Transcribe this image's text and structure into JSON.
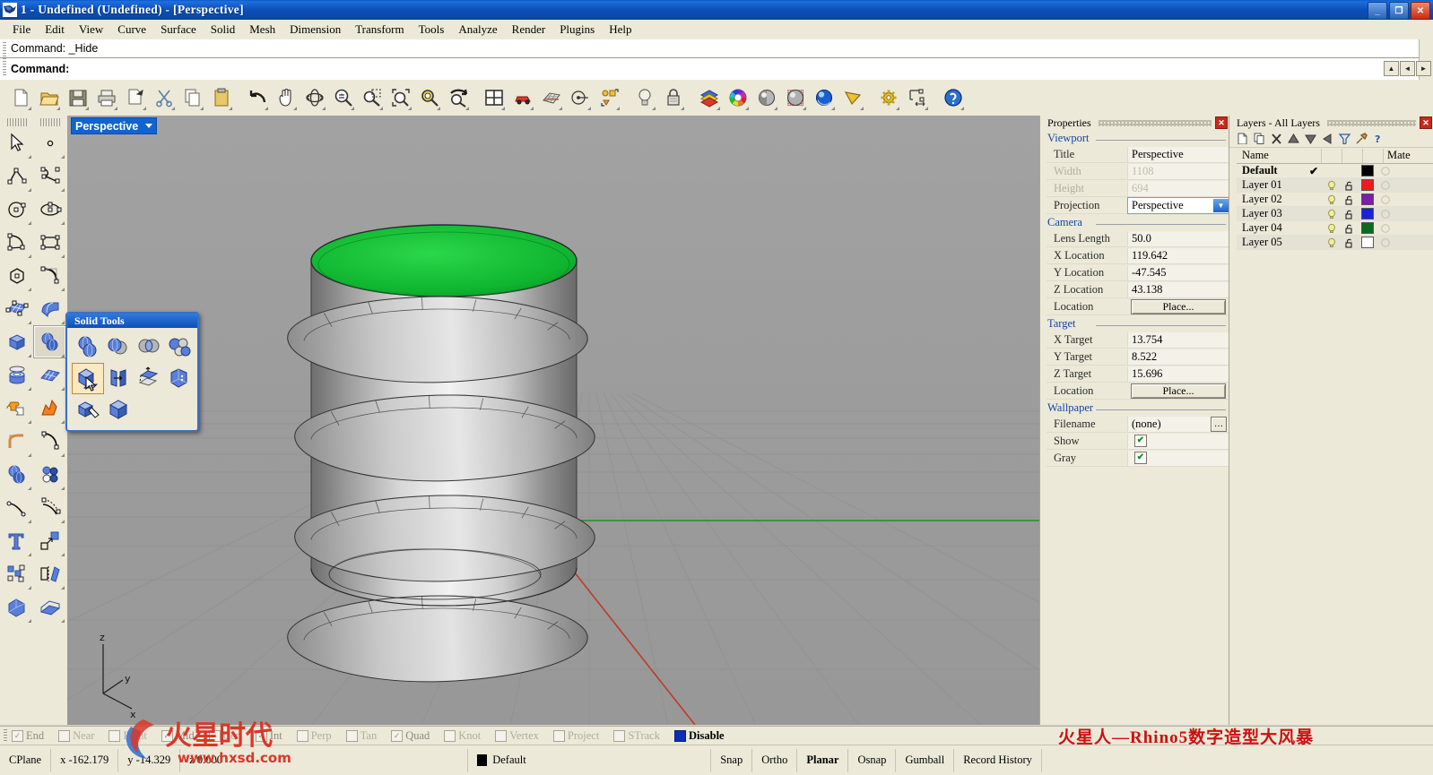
{
  "window": {
    "title": "1 - Undefined (Undefined) - [Perspective]",
    "app_icon": "rhino-logo-icon",
    "minimize_label": "_",
    "restore_label": "❐",
    "close_label": "✕"
  },
  "menubar": {
    "items": [
      {
        "label": "File",
        "accel": "F"
      },
      {
        "label": "Edit",
        "accel": "E"
      },
      {
        "label": "View",
        "accel": "V"
      },
      {
        "label": "Curve",
        "accel": "C"
      },
      {
        "label": "Surface",
        "accel": "S"
      },
      {
        "label": "Solid",
        "accel": "l"
      },
      {
        "label": "Mesh",
        "accel": "M"
      },
      {
        "label": "Dimension",
        "accel": "D"
      },
      {
        "label": "Transform",
        "accel": "T"
      },
      {
        "label": "Tools",
        "accel": "s"
      },
      {
        "label": "Analyze",
        "accel": "A"
      },
      {
        "label": "Render",
        "accel": "R"
      },
      {
        "label": "Plugins",
        "accel": "P"
      },
      {
        "label": "Help",
        "accel": "H"
      }
    ]
  },
  "command": {
    "history_line": "Command: _Hide",
    "prompt_line": "Command:",
    "scroll_up": "▲",
    "scroll_prev": "◄",
    "scroll_next": "►"
  },
  "toolbar": {
    "buttons": [
      {
        "name": "new-file-icon",
        "tip": "New"
      },
      {
        "name": "open-file-icon",
        "tip": "Open"
      },
      {
        "name": "save-file-icon",
        "tip": "Save"
      },
      {
        "name": "print-icon",
        "tip": "Print"
      },
      {
        "name": "cut-page-icon",
        "tip": "Cut"
      },
      {
        "name": "scissors-icon",
        "tip": "Cut"
      },
      {
        "name": "copy-icon",
        "tip": "Copy"
      },
      {
        "name": "paste-icon",
        "tip": "Paste"
      },
      {
        "name": "undo-icon",
        "tip": "Undo"
      },
      {
        "name": "pan-hand-icon",
        "tip": "Pan"
      },
      {
        "name": "rotate-view-icon",
        "tip": "Rotate View"
      },
      {
        "name": "zoom-in-out-icon",
        "tip": "Zoom"
      },
      {
        "name": "zoom-window-icon",
        "tip": "Zoom Window"
      },
      {
        "name": "zoom-extents-icon",
        "tip": "Zoom Extents"
      },
      {
        "name": "zoom-selected-icon",
        "tip": "Zoom Selected"
      },
      {
        "name": "zoom-previous-icon",
        "tip": "Zoom Previous"
      },
      {
        "name": "four-view-icon",
        "tip": "4 Viewports"
      },
      {
        "name": "car-icon",
        "tip": "Named Views"
      },
      {
        "name": "grid-plane-icon",
        "tip": "CPlane"
      },
      {
        "name": "circle-radius-icon",
        "tip": "Set CPlane"
      },
      {
        "name": "select-objects-icon",
        "tip": "Selection"
      },
      {
        "name": "light-bulb-icon",
        "tip": "Lights"
      },
      {
        "name": "lock-icon",
        "tip": "Lock"
      },
      {
        "name": "layers-stack-icon",
        "tip": "Layers"
      },
      {
        "name": "color-wheel-icon",
        "tip": "Object Color"
      },
      {
        "name": "shaded-sphere-icon",
        "tip": "Shaded"
      },
      {
        "name": "ghosted-sphere-icon",
        "tip": "Ghosted"
      },
      {
        "name": "rendered-sphere-icon",
        "tip": "Rendered"
      },
      {
        "name": "render-preview-icon",
        "tip": "Render"
      },
      {
        "name": "options-gear-icon",
        "tip": "Options"
      },
      {
        "name": "dimension-icon",
        "tip": "Dimension"
      },
      {
        "name": "help-icon",
        "tip": "Help"
      }
    ]
  },
  "left_toolbar": {
    "column_left": [
      "arrow-select-icon",
      "polyline-icon",
      "circle-icon",
      "arc-icon",
      "polygon-icon",
      "surface-grid-icon",
      "box-solid-icon",
      "cylinder-solid-icon",
      "puzzle-boolean-icon",
      "fillet-edge-icon",
      "spheres-union-icon",
      "curve-point-icon",
      "text-tool-icon",
      "array-icon",
      "solid-tools-icon"
    ],
    "column_right": [
      "point-icon",
      "curve-freeform-icon",
      "ellipse-icon",
      "rectangle-icon",
      "curve-corner-icon",
      "surface-sweep-icon",
      "sphere-pair-icon",
      "surface-patch-icon",
      "explode-icon",
      "fillet-icon",
      "circles-icon",
      "offset-curve-icon",
      "scale-icon",
      "mirror-icon",
      "mesh-tools-icon"
    ]
  },
  "viewport": {
    "label": "Perspective",
    "dropdown_glyph": "▼",
    "axis_z": "z",
    "axis_y": "y",
    "axis_x": "x"
  },
  "solid_tools_palette": {
    "title": "Solid Tools",
    "buttons": [
      {
        "name": "boolean-union-icon",
        "selected": false
      },
      {
        "name": "boolean-difference-icon",
        "selected": false
      },
      {
        "name": "boolean-intersection-icon",
        "selected": false
      },
      {
        "name": "boolean-split-icon",
        "selected": false
      },
      {
        "name": "extract-surface-icon",
        "selected": true
      },
      {
        "name": "cap-planar-holes-icon",
        "selected": false
      },
      {
        "name": "offset-surface-icon",
        "selected": false
      },
      {
        "name": "solid-edit-points-icon",
        "selected": false
      },
      {
        "name": "extract-face-icon",
        "selected": false
      },
      {
        "name": "box-edit-icon",
        "selected": false
      }
    ]
  },
  "properties_panel": {
    "title": "Properties",
    "close_label": "✕",
    "groups": [
      {
        "name": "Viewport",
        "rows": [
          {
            "key": "Title",
            "value": "Perspective",
            "type": "text",
            "dim": false
          },
          {
            "key": "Width",
            "value": "1108",
            "type": "text",
            "dim": true
          },
          {
            "key": "Height",
            "value": "694",
            "type": "text",
            "dim": true
          },
          {
            "key": "Projection",
            "value": "Perspective",
            "type": "select",
            "dim": false
          }
        ]
      },
      {
        "name": "Camera",
        "rows": [
          {
            "key": "Lens Length",
            "value": "50.0",
            "type": "text",
            "dim": false
          },
          {
            "key": "X Location",
            "value": "119.642",
            "type": "text",
            "dim": false
          },
          {
            "key": "Y Location",
            "value": "-47.545",
            "type": "text",
            "dim": false
          },
          {
            "key": "Z Location",
            "value": "43.138",
            "type": "text",
            "dim": false
          },
          {
            "key": "Location",
            "value": "Place...",
            "type": "button",
            "dim": false
          }
        ]
      },
      {
        "name": "Target",
        "rows": [
          {
            "key": "X Target",
            "value": "13.754",
            "type": "text",
            "dim": false
          },
          {
            "key": "Y Target",
            "value": "8.522",
            "type": "text",
            "dim": false
          },
          {
            "key": "Z Target",
            "value": "15.696",
            "type": "text",
            "dim": false
          },
          {
            "key": "Location",
            "value": "Place...",
            "type": "button",
            "dim": false
          }
        ]
      },
      {
        "name": "Wallpaper",
        "rows": [
          {
            "key": "Filename",
            "value": "(none)",
            "type": "file",
            "dim": false
          },
          {
            "key": "Show",
            "value": "✔",
            "type": "checkbox",
            "dim": false
          },
          {
            "key": "Gray",
            "value": "✔",
            "type": "checkbox",
            "dim": false
          }
        ]
      }
    ]
  },
  "layers_panel": {
    "title": "Layers - All Layers",
    "close_label": "✕",
    "toolbar_icons": [
      "new-layer-icon",
      "copy-layer-icon",
      "delete-layer-icon",
      "move-up-icon",
      "move-down-icon",
      "move-left-icon",
      "filter-icon",
      "layer-properties-icon",
      "help-icon"
    ],
    "columns": [
      "Name",
      "",
      "",
      "",
      "Mate"
    ],
    "rows": [
      {
        "name": "Default",
        "current": true,
        "check": "✔",
        "bulb": false,
        "lock": false,
        "color": "#000000"
      },
      {
        "name": "Layer 01",
        "current": false,
        "check": "",
        "bulb": true,
        "lock": true,
        "color": "#ee1b1b"
      },
      {
        "name": "Layer 02",
        "current": false,
        "check": "",
        "bulb": true,
        "lock": true,
        "color": "#7a1fa8"
      },
      {
        "name": "Layer 03",
        "current": false,
        "check": "",
        "bulb": true,
        "lock": true,
        "color": "#1a22d8"
      },
      {
        "name": "Layer 04",
        "current": false,
        "check": "",
        "bulb": true,
        "lock": true,
        "color": "#0a6a1e"
      },
      {
        "name": "Layer 05",
        "current": false,
        "check": "",
        "bulb": true,
        "lock": true,
        "color": "#ffffff"
      }
    ],
    "scroll_left": "◄",
    "scroll_right": "►"
  },
  "osnap_bar": {
    "items": [
      {
        "label": "End",
        "checked": true
      },
      {
        "label": "Near",
        "checked": false
      },
      {
        "label": "Point",
        "checked": false
      },
      {
        "label": "Mid",
        "checked": true
      },
      {
        "label": "Cen",
        "checked": false
      },
      {
        "label": "Int",
        "checked": true
      },
      {
        "label": "Perp",
        "checked": false
      },
      {
        "label": "Tan",
        "checked": false
      },
      {
        "label": "Quad",
        "checked": true
      },
      {
        "label": "Knot",
        "checked": false
      },
      {
        "label": "Vertex",
        "checked": false
      },
      {
        "label": "Project",
        "checked": false
      },
      {
        "label": "STrack",
        "checked": false
      },
      {
        "label": "Disable",
        "checked": true,
        "highlight": true
      }
    ]
  },
  "status_bar": {
    "cplane_label": "CPlane",
    "x_label": "x",
    "x_value": "-162.179",
    "y_label": "y",
    "y_value": "-14.329",
    "z_label": "z",
    "z_value": "0.000",
    "layer_name": "Default",
    "layer_color": "#000000",
    "toggles": [
      {
        "label": "Snap",
        "active": false
      },
      {
        "label": "Ortho",
        "active": false
      },
      {
        "label": "Planar",
        "active": true
      },
      {
        "label": "Osnap",
        "active": false
      },
      {
        "label": "Gumball",
        "active": false
      },
      {
        "label": "Record History",
        "active": false
      }
    ]
  },
  "watermarks": {
    "logo_text": "火星时代",
    "url_text": "www.hxsd.com",
    "banner_text": "火星人—Rhino5数字造型大风暴"
  }
}
